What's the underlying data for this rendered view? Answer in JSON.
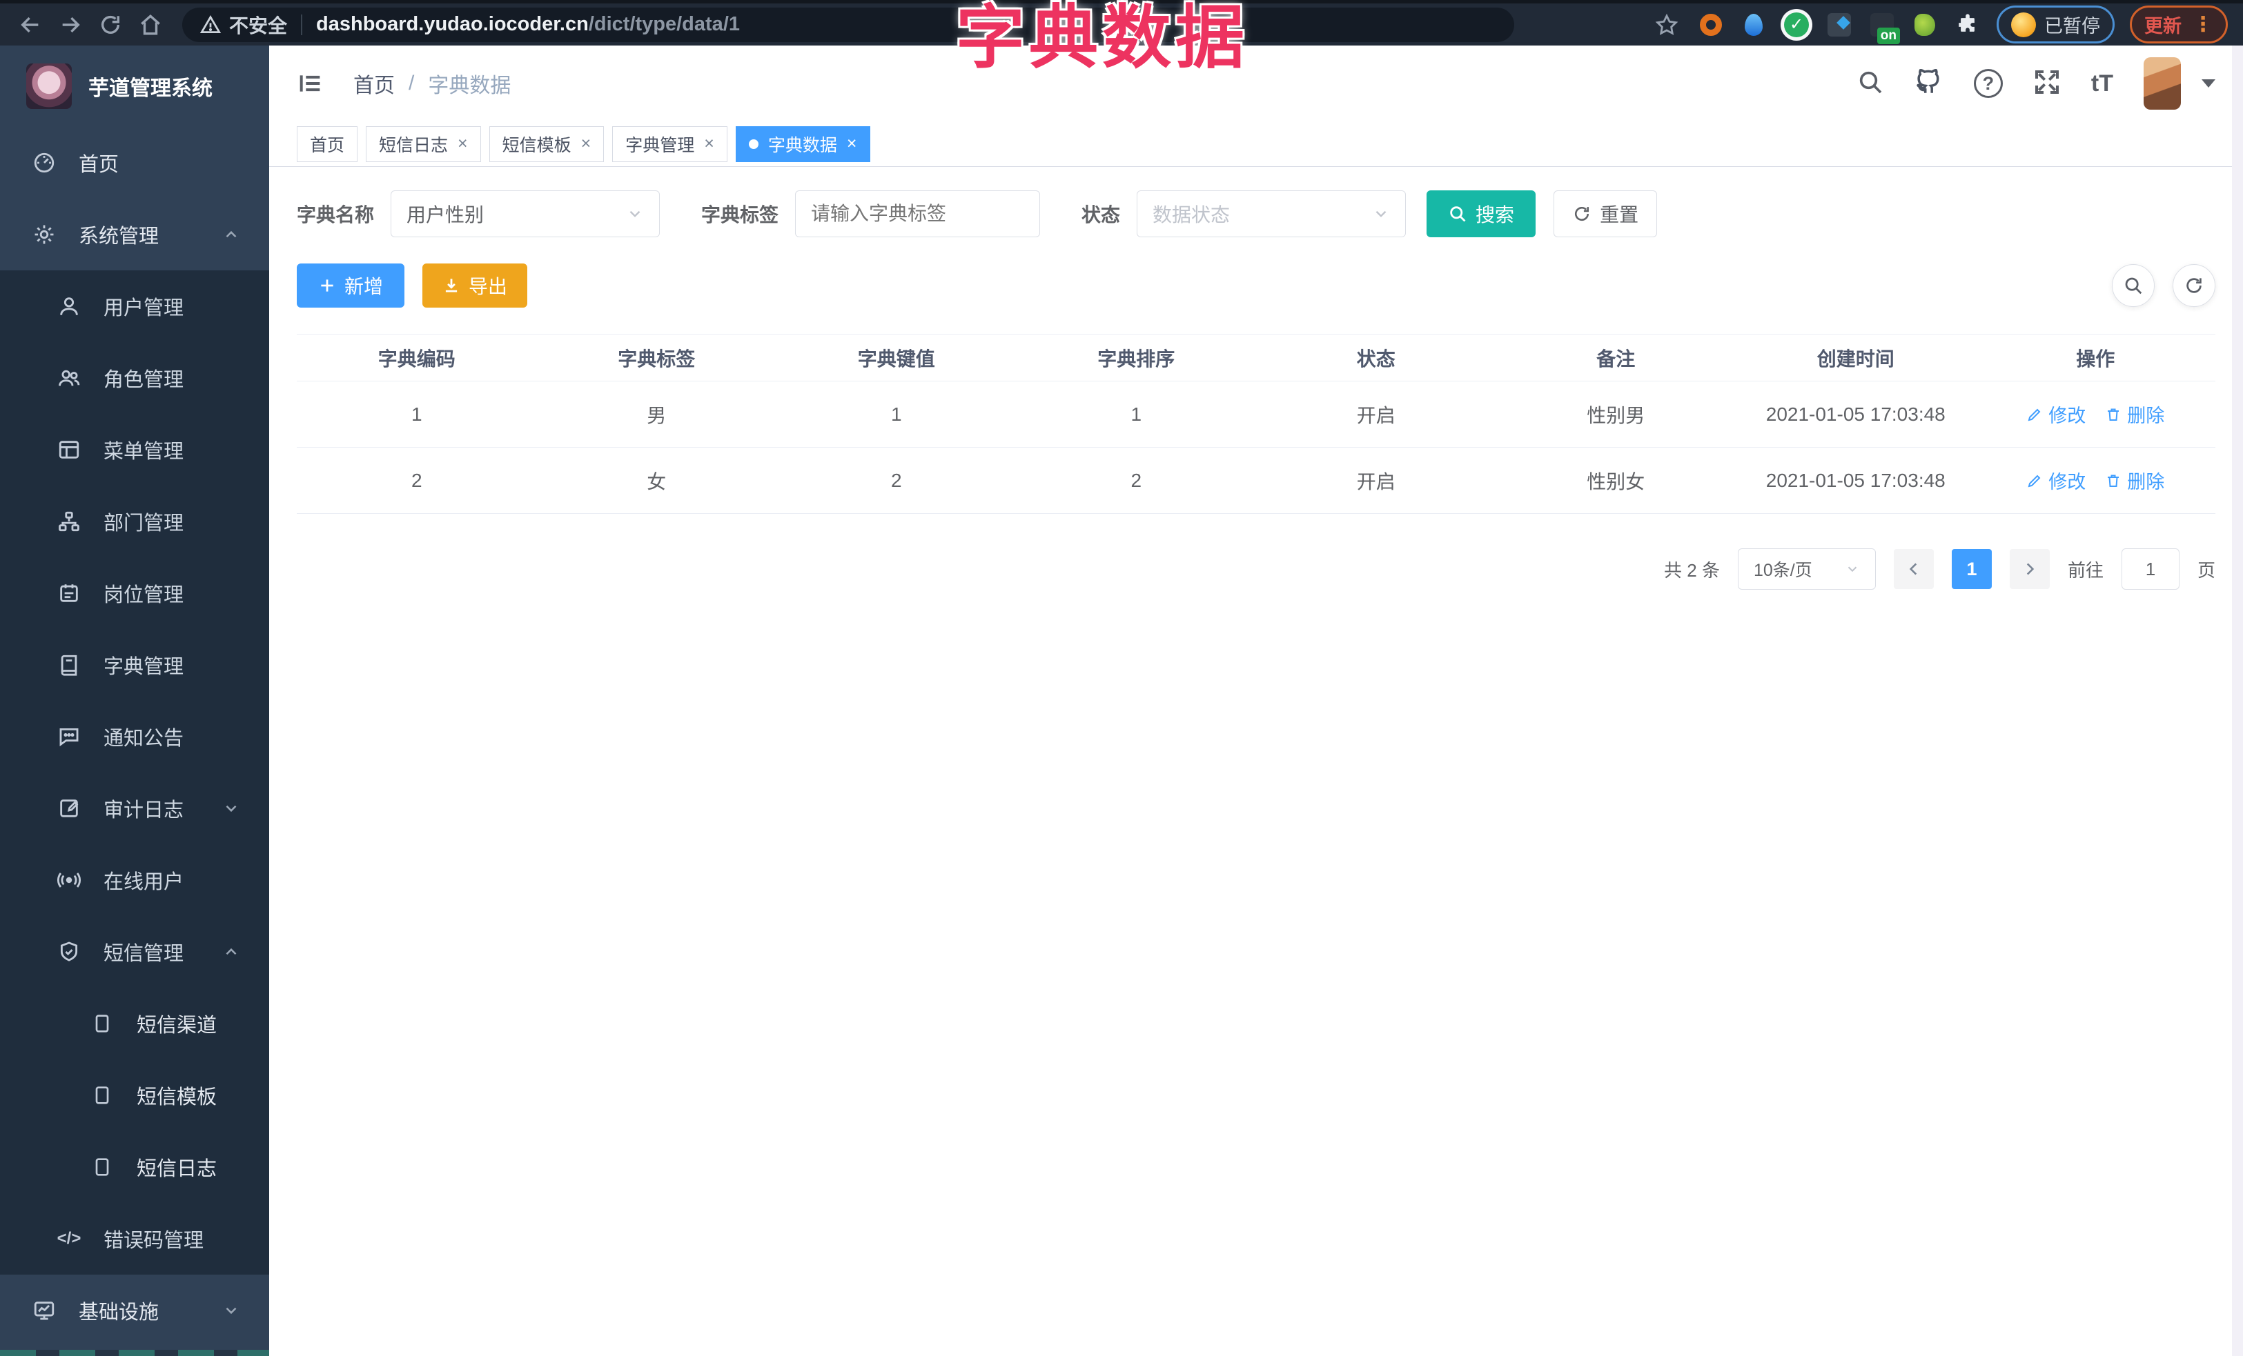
{
  "browser": {
    "security_label": "不安全",
    "url_host": "dashboard.yudao.iocoder.cn",
    "url_path": "/dict/type/data/1",
    "extension_on_badge": "on",
    "paused_label": "已暂停",
    "update_label": "更新"
  },
  "overlay_title": "字典数据",
  "icons": {
    "close": "×",
    "question": "?",
    "font_size": "tT",
    "code": "</>",
    "kebab": "⋮"
  },
  "sidebar": {
    "app_title": "芋道管理系统",
    "items": [
      {
        "label": "首页"
      },
      {
        "label": "系统管理"
      },
      {
        "label": "用户管理"
      },
      {
        "label": "角色管理"
      },
      {
        "label": "菜单管理"
      },
      {
        "label": "部门管理"
      },
      {
        "label": "岗位管理"
      },
      {
        "label": "字典管理"
      },
      {
        "label": "通知公告"
      },
      {
        "label": "审计日志"
      },
      {
        "label": "在线用户"
      },
      {
        "label": "短信管理"
      },
      {
        "label": "短信渠道"
      },
      {
        "label": "短信模板"
      },
      {
        "label": "短信日志"
      },
      {
        "label": "错误码管理"
      },
      {
        "label": "基础设施"
      }
    ]
  },
  "header": {
    "breadcrumb_home": "首页",
    "breadcrumb_sep": "/",
    "breadcrumb_current": "字典数据"
  },
  "tabs": [
    {
      "label": "首页"
    },
    {
      "label": "短信日志"
    },
    {
      "label": "短信模板"
    },
    {
      "label": "字典管理"
    },
    {
      "label": "字典数据"
    }
  ],
  "filters": {
    "dict_name_label": "字典名称",
    "dict_name_value": "用户性别",
    "dict_label_label": "字典标签",
    "dict_label_placeholder": "请输入字典标签",
    "status_label": "状态",
    "status_placeholder": "数据状态",
    "search_label": "搜索",
    "reset_label": "重置"
  },
  "toolbar": {
    "add_label": "新增",
    "export_label": "导出"
  },
  "table": {
    "columns": [
      "字典编码",
      "字典标签",
      "字典键值",
      "字典排序",
      "状态",
      "备注",
      "创建时间",
      "操作"
    ],
    "rows": [
      {
        "code": "1",
        "label": "男",
        "value": "1",
        "sort": "1",
        "status": "开启",
        "remark": "性别男",
        "created": "2021-01-05 17:03:48"
      },
      {
        "code": "2",
        "label": "女",
        "value": "2",
        "sort": "2",
        "status": "开启",
        "remark": "性别女",
        "created": "2021-01-05 17:03:48"
      }
    ],
    "edit_label": "修改",
    "delete_label": "删除"
  },
  "pagination": {
    "total_label": "共 2 条",
    "page_size": "10条/页",
    "current_page": "1",
    "goto_label": "前往",
    "goto_value": "1",
    "page_suffix": "页"
  },
  "colors": {
    "accent_blue": "#409eff",
    "search_teal": "#17b8a6",
    "export_amber": "#efa51d",
    "sidebar_bg": "#304156",
    "sidebar_sub_bg": "#1f2d3d",
    "overlay_red": "#ed3360"
  }
}
